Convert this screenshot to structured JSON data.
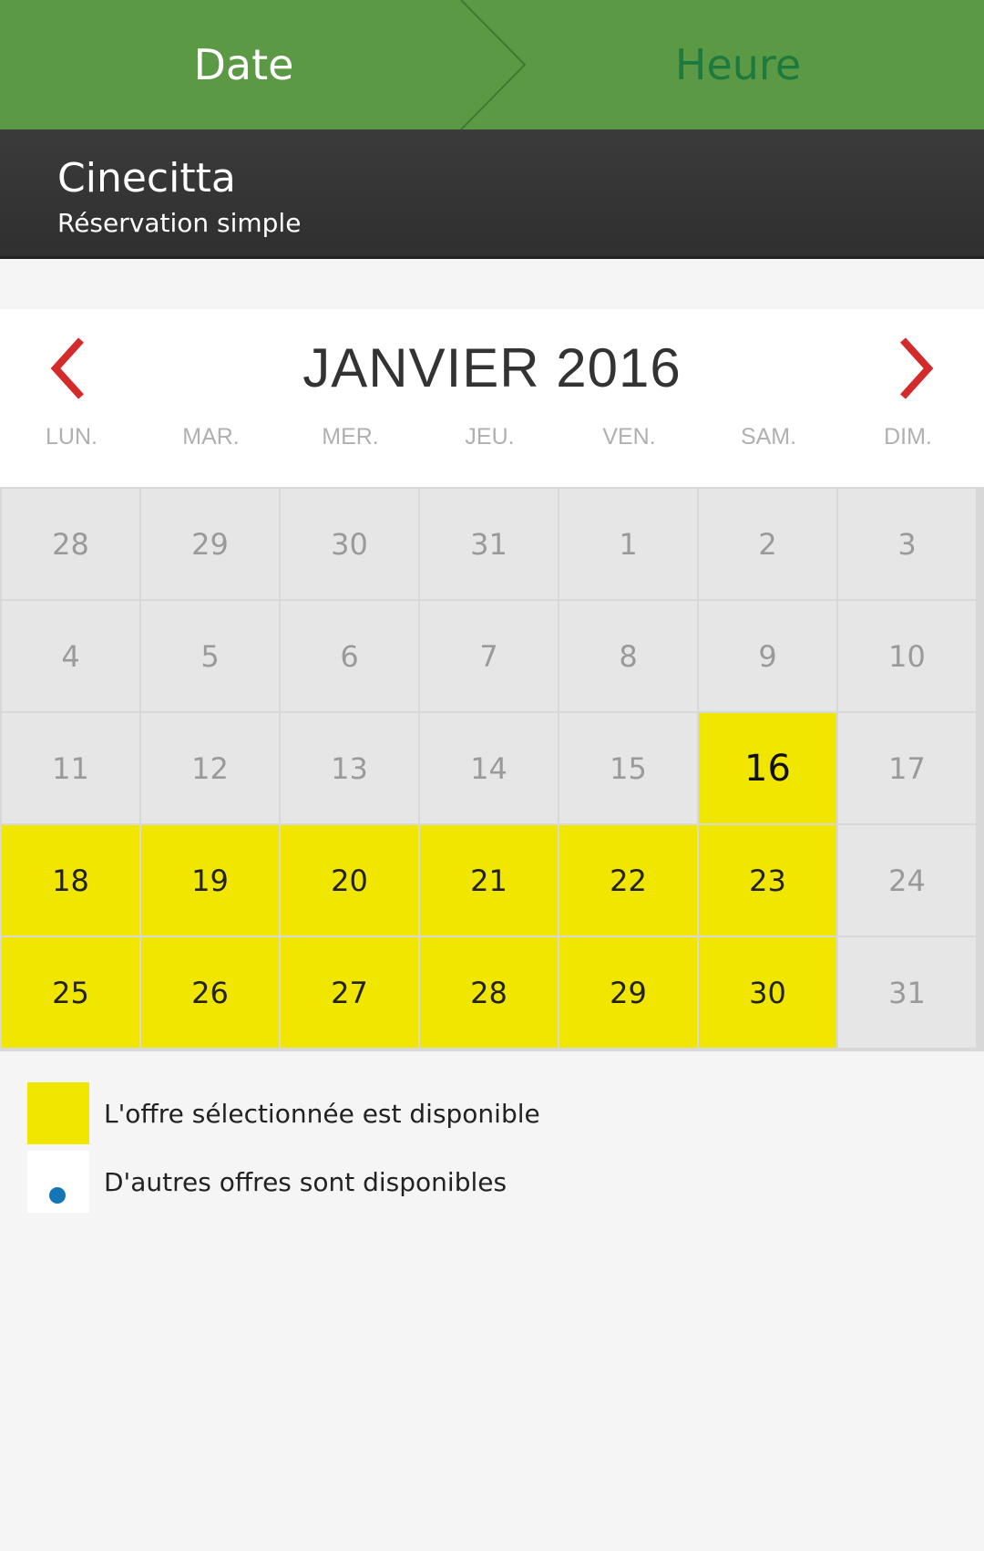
{
  "wizard": {
    "step_date": "Date",
    "step_heure": "Heure"
  },
  "title_bar": {
    "name": "Cinecitta",
    "subtitle": "Réservation simple"
  },
  "calendar": {
    "month_title": "JANVIER 2016",
    "prev_icon": "chevron-left-icon",
    "next_icon": "chevron-right-icon",
    "weekdays": [
      "LUN.",
      "MAR.",
      "MER.",
      "JEU.",
      "VEN.",
      "SAM.",
      "DIM."
    ],
    "weeks": [
      [
        {
          "day": "28",
          "state": "unavailable"
        },
        {
          "day": "29",
          "state": "unavailable"
        },
        {
          "day": "30",
          "state": "unavailable"
        },
        {
          "day": "31",
          "state": "unavailable"
        },
        {
          "day": "1",
          "state": "unavailable"
        },
        {
          "day": "2",
          "state": "unavailable"
        },
        {
          "day": "3",
          "state": "unavailable"
        }
      ],
      [
        {
          "day": "4",
          "state": "unavailable"
        },
        {
          "day": "5",
          "state": "unavailable"
        },
        {
          "day": "6",
          "state": "unavailable"
        },
        {
          "day": "7",
          "state": "unavailable"
        },
        {
          "day": "8",
          "state": "unavailable"
        },
        {
          "day": "9",
          "state": "unavailable"
        },
        {
          "day": "10",
          "state": "unavailable"
        }
      ],
      [
        {
          "day": "11",
          "state": "unavailable"
        },
        {
          "day": "12",
          "state": "unavailable"
        },
        {
          "day": "13",
          "state": "unavailable"
        },
        {
          "day": "14",
          "state": "unavailable"
        },
        {
          "day": "15",
          "state": "unavailable"
        },
        {
          "day": "16",
          "state": "selected"
        },
        {
          "day": "17",
          "state": "unavailable"
        }
      ],
      [
        {
          "day": "18",
          "state": "available"
        },
        {
          "day": "19",
          "state": "available"
        },
        {
          "day": "20",
          "state": "available"
        },
        {
          "day": "21",
          "state": "available"
        },
        {
          "day": "22",
          "state": "available"
        },
        {
          "day": "23",
          "state": "available"
        },
        {
          "day": "24",
          "state": "unavailable"
        }
      ],
      [
        {
          "day": "25",
          "state": "available"
        },
        {
          "day": "26",
          "state": "available"
        },
        {
          "day": "27",
          "state": "available"
        },
        {
          "day": "28",
          "state": "available"
        },
        {
          "day": "29",
          "state": "available"
        },
        {
          "day": "30",
          "state": "available"
        },
        {
          "day": "31",
          "state": "unavailable"
        }
      ]
    ]
  },
  "legend": {
    "offer_available": "L'offre sélectionnée est disponible",
    "other_offers": "D'autres offres sont disponibles"
  },
  "colors": {
    "header_green": "#5c9945",
    "heure_green": "#1c7a3e",
    "available_yellow": "#f0e600",
    "chevron_red": "#d42a2a",
    "dot_blue": "#1476b5"
  }
}
